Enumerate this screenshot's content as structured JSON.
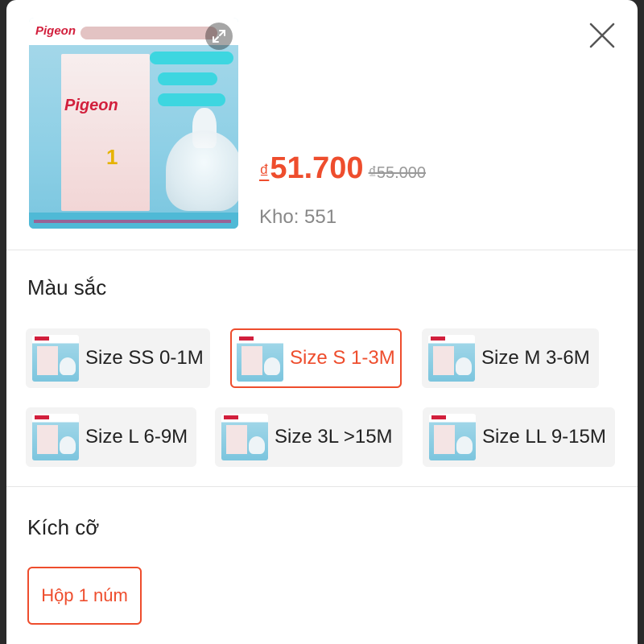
{
  "product": {
    "thumb_brand": "Pigeon",
    "price_currency": "₫",
    "price": "51.700",
    "old_price": "₫55.000",
    "stock_label": "Kho: 551"
  },
  "color_section": {
    "title": "Màu sắc",
    "options": [
      {
        "label": "Size SS 0-1M",
        "selected": false
      },
      {
        "label": "Size S 1-3M",
        "selected": true
      },
      {
        "label": "Size M 3-6M",
        "selected": false
      },
      {
        "label": "Size L 6-9M",
        "selected": false
      },
      {
        "label": "Size 3L >15M",
        "selected": false
      },
      {
        "label": "Size LL 9-15M",
        "selected": false
      }
    ]
  },
  "size_section": {
    "title": "Kích cỡ",
    "options": [
      {
        "label": "Hộp 1 núm",
        "selected": true
      }
    ]
  },
  "colors": {
    "accent": "#ee4d2d",
    "muted": "#888888",
    "option_bg": "#f3f3f3"
  },
  "icons": {
    "close": "close-icon",
    "expand": "expand-icon"
  }
}
